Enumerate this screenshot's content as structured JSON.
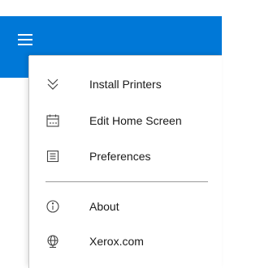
{
  "header": {
    "menu_button": "hamburger-menu",
    "color": "#0078d7"
  },
  "menu": {
    "items": [
      {
        "label": "Install Printers",
        "icon": "chevron-double-down-icon"
      },
      {
        "label": "Edit Home Screen",
        "icon": "calendar-icon"
      },
      {
        "label": "Preferences",
        "icon": "list-document-icon"
      }
    ],
    "secondary_items": [
      {
        "label": "About",
        "icon": "info-icon"
      },
      {
        "label": "Xerox.com",
        "icon": "globe-icon"
      }
    ]
  }
}
